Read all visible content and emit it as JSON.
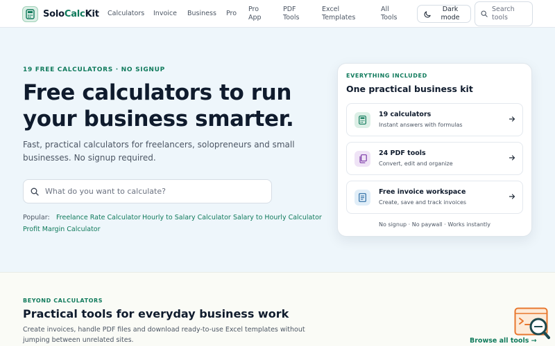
{
  "brand": {
    "name_part1": "Solo",
    "name_part2": "Calc",
    "name_part3": "Kit"
  },
  "nav": {
    "links": [
      "Calculators",
      "Invoice",
      "Business",
      "Pro",
      "Pro App",
      "PDF Tools",
      "Excel Templates",
      "All Tools"
    ],
    "dark_mode_label": "Dark mode",
    "search_label": "Search tools"
  },
  "hero": {
    "eyebrow": "19 FREE CALCULATORS · NO SIGNUP",
    "title": "Free calculators to run your business smarter.",
    "subtitle": "Fast, practical calculators for freelancers, solopreneurs and small businesses. No signup required.",
    "search_placeholder": "What do you want to calculate?",
    "popular_label": "Popular:",
    "popular_links": [
      "Freelance Rate Calculator",
      "Hourly to Salary Calculator",
      "Salary to Hourly Calculator",
      "Profit Margin Calculator"
    ]
  },
  "card": {
    "eyebrow": "EVERYTHING INCLUDED",
    "title": "One practical business kit",
    "features": [
      {
        "title": "19 calculators",
        "desc": "Instant answers with formulas",
        "icon": "calculator-icon",
        "icon_bg": "#dcefe6",
        "icon_color": "#0f7a5b"
      },
      {
        "title": "24 PDF tools",
        "desc": "Convert, edit and organize",
        "icon": "pdf-files-icon",
        "icon_bg": "#efe3f6",
        "icon_color": "#7c3aa8"
      },
      {
        "title": "Free invoice workspace",
        "desc": "Create, save and track invoices",
        "icon": "invoice-icon",
        "icon_bg": "#e1eef8",
        "icon_color": "#2b6ca3"
      }
    ],
    "footer": "No signup · No paywall · Works instantly"
  },
  "lower": {
    "eyebrow": "BEYOND CALCULATORS",
    "title": "Practical tools for everyday business work",
    "subtitle": "Create invoices, handle PDF files and download ready-to-use Excel templates without jumping between unrelated sites.",
    "browse_label": "Browse all tools →"
  },
  "colors": {
    "accent": "#0f7a5b",
    "hero_bg": "#eef6fb",
    "text": "#0f1b2d",
    "corner_icon": "#e8772e"
  }
}
